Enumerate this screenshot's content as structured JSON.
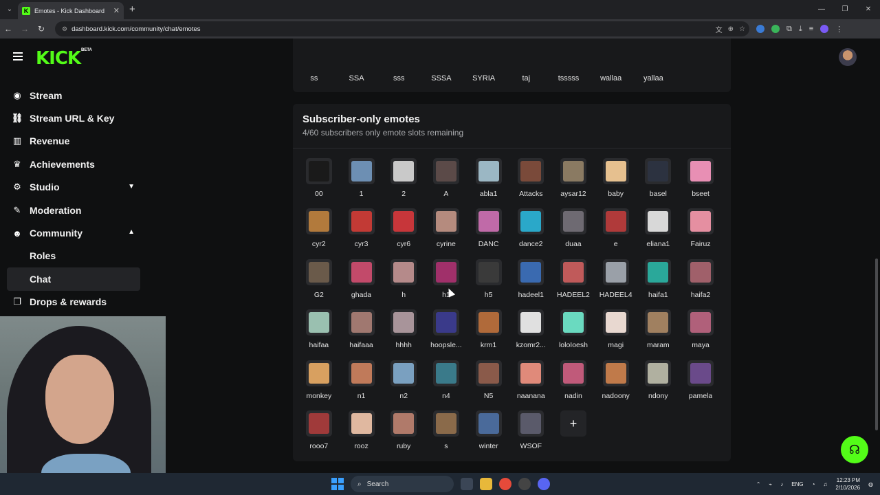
{
  "browser": {
    "tab_title": "Emotes - Kick Dashboard",
    "url": "dashboard.kick.com/community/chat/emotes"
  },
  "app": {
    "logo": "KICK",
    "logo_badge": "BETA"
  },
  "sidebar": {
    "items": [
      {
        "label": "Stream",
        "icon": "broadcast-icon"
      },
      {
        "label": "Stream URL & Key",
        "icon": "link-icon"
      },
      {
        "label": "Revenue",
        "icon": "chart-icon"
      },
      {
        "label": "Achievements",
        "icon": "trophy-icon"
      },
      {
        "label": "Studio",
        "icon": "gear-icon"
      },
      {
        "label": "Moderation",
        "icon": "wrench-icon"
      },
      {
        "label": "Community",
        "icon": "users-icon"
      },
      {
        "label": "Roles",
        "icon": ""
      },
      {
        "label": "Chat",
        "icon": ""
      },
      {
        "label": "Drops & rewards",
        "icon": "gift-icon"
      }
    ]
  },
  "previous_section": {
    "emotes": [
      "ss",
      "SSA",
      "sss",
      "SSSA",
      "SYRIA",
      "taj",
      "tsssss",
      "wallaa",
      "yallaa"
    ]
  },
  "subscriber_emotes": {
    "title": "Subscriber-only emotes",
    "subtitle": "4/60 subscribers only emote slots remaining",
    "emotes": [
      {
        "name": "00",
        "color": "#1a1a1a"
      },
      {
        "name": "1",
        "color": "#6d8fb3"
      },
      {
        "name": "2",
        "color": "#c9c9c9"
      },
      {
        "name": "A",
        "color": "#5b4a48"
      },
      {
        "name": "abla1",
        "color": "#9bb7c4"
      },
      {
        "name": "Attacks",
        "color": "#7a4a3a"
      },
      {
        "name": "aysar12",
        "color": "#8a7a62"
      },
      {
        "name": "baby",
        "color": "#e6c08f"
      },
      {
        "name": "basel",
        "color": "#2c3240"
      },
      {
        "name": "bseet",
        "color": "#e88fb4"
      },
      {
        "name": "cyr2",
        "color": "#b27a3c"
      },
      {
        "name": "cyr3",
        "color": "#c23a35"
      },
      {
        "name": "cyr6",
        "color": "#c7363a"
      },
      {
        "name": "cyrine",
        "color": "#b58b7e"
      },
      {
        "name": "DANC",
        "color": "#c06aa8"
      },
      {
        "name": "dance2",
        "color": "#2aa8c9"
      },
      {
        "name": "duaa",
        "color": "#6e6a72"
      },
      {
        "name": "e",
        "color": "#b03a3a"
      },
      {
        "name": "eliana1",
        "color": "#d8d8d8"
      },
      {
        "name": "Fairuz",
        "color": "#e58fa1"
      },
      {
        "name": "G2",
        "color": "#6a5a4a"
      },
      {
        "name": "ghada",
        "color": "#c24a6a"
      },
      {
        "name": "h",
        "color": "#b58a8a"
      },
      {
        "name": "h1",
        "color": "#a0306a"
      },
      {
        "name": "h5",
        "color": "#3a3a3a"
      },
      {
        "name": "hadeel1",
        "color": "#3a6ab0"
      },
      {
        "name": "HADEEL2",
        "color": "#c05a5a"
      },
      {
        "name": "HADEEL4",
        "color": "#9aa0a8"
      },
      {
        "name": "haifa1",
        "color": "#2aa89a"
      },
      {
        "name": "haifa2",
        "color": "#a0606a"
      },
      {
        "name": "haifaa",
        "color": "#9ac0b0"
      },
      {
        "name": "haifaaa",
        "color": "#a07870"
      },
      {
        "name": "hhhh",
        "color": "#a8949a"
      },
      {
        "name": "hoopsle...",
        "color": "#3a3a8a"
      },
      {
        "name": "krm1",
        "color": "#b06a3a"
      },
      {
        "name": "kzomr2...",
        "color": "#e0e0e0"
      },
      {
        "name": "loloIoesh",
        "color": "#6adac0"
      },
      {
        "name": "magi",
        "color": "#e8d8d0"
      },
      {
        "name": "maram",
        "color": "#a08060"
      },
      {
        "name": "maya",
        "color": "#b0607a"
      },
      {
        "name": "monkey",
        "color": "#d8a060"
      },
      {
        "name": "n1",
        "color": "#c07a5a"
      },
      {
        "name": "n2",
        "color": "#7aa0c0"
      },
      {
        "name": "n4",
        "color": "#3a7a8a"
      },
      {
        "name": "N5",
        "color": "#8a5a4a"
      },
      {
        "name": "naanana",
        "color": "#e08a7a"
      },
      {
        "name": "nadin",
        "color": "#c05a7a"
      },
      {
        "name": "nadoony",
        "color": "#c07a4a"
      },
      {
        "name": "ndony",
        "color": "#b0b0a0"
      },
      {
        "name": "pamela",
        "color": "#6a4a8a"
      },
      {
        "name": "rooo7",
        "color": "#a03a3a"
      },
      {
        "name": "rooz",
        "color": "#e0b8a0"
      },
      {
        "name": "ruby",
        "color": "#b07a6a"
      },
      {
        "name": "s",
        "color": "#8a6a4a"
      },
      {
        "name": "winter",
        "color": "#4a6a9a"
      },
      {
        "name": "WSOF",
        "color": "#5a5a6a"
      }
    ],
    "add_label": "+"
  },
  "taskbar": {
    "search_label": "Search",
    "lang": "ENG",
    "time": "12:23 PM",
    "date": "2/10/2026"
  }
}
